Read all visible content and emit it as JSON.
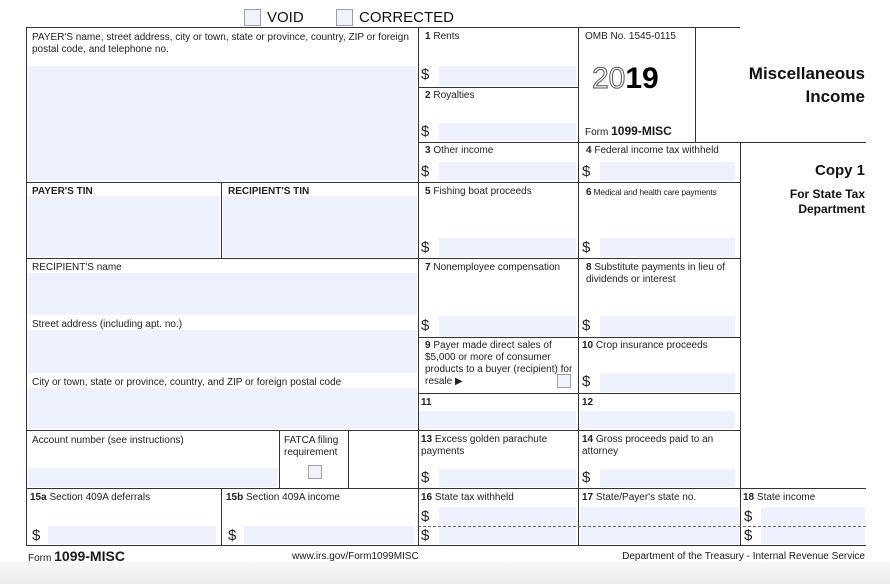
{
  "header": {
    "void_label": "VOID",
    "corrected_label": "CORRECTED"
  },
  "payer_block": {
    "label": "PAYER'S name, street address, city or town, state or province, country, ZIP or foreign postal code, and telephone no."
  },
  "payer_tin": {
    "label": "PAYER'S TIN"
  },
  "recipient_tin": {
    "label": "RECIPIENT'S TIN"
  },
  "recipient_name": {
    "label": "RECIPIENT'S name"
  },
  "street_address": {
    "label": "Street address (including apt. no.)"
  },
  "city": {
    "label": "City or town, state or province, country, and ZIP or foreign postal code"
  },
  "account_number": {
    "label": "Account number (see instructions)"
  },
  "fatca": {
    "label": "FATCA filing requirement",
    "checked": false
  },
  "omb": {
    "number": "OMB No. 1545-0115",
    "year_outline": "20",
    "year_bold": "19",
    "form_prefix": "Form",
    "form_name": "1099-MISC"
  },
  "title": {
    "line1": "Miscellaneous",
    "line2": "Income",
    "copy": "Copy 1",
    "copy_desc1": "For State Tax",
    "copy_desc2": "Department"
  },
  "currency_symbol": "$",
  "boxes": {
    "b1": {
      "num": "1",
      "label": "Rents",
      "value": ""
    },
    "b2": {
      "num": "2",
      "label": "Royalties",
      "value": ""
    },
    "b3": {
      "num": "3",
      "label": "Other income",
      "value": ""
    },
    "b4": {
      "num": "4",
      "label": "Federal income tax withheld",
      "value": ""
    },
    "b5": {
      "num": "5",
      "label": "Fishing boat proceeds",
      "value": ""
    },
    "b6": {
      "num": "6",
      "label": "Medical and health care payments",
      "value": ""
    },
    "b7": {
      "num": "7",
      "label": "Nonemployee compensation",
      "value": ""
    },
    "b8": {
      "num": "8",
      "label": "Substitute payments in lieu of dividends or interest",
      "value": ""
    },
    "b9": {
      "num": "9",
      "label": "Payer made direct sales of $5,000 or more of consumer products to a buyer (recipient) for resale ▶",
      "checked": false
    },
    "b10": {
      "num": "10",
      "label": "Crop insurance proceeds",
      "value": ""
    },
    "b11": {
      "num": "11",
      "label": "",
      "value": ""
    },
    "b12": {
      "num": "12",
      "label": "",
      "value": ""
    },
    "b13": {
      "num": "13",
      "label": "Excess golden parachute payments",
      "value": ""
    },
    "b14": {
      "num": "14",
      "label": "Gross proceeds paid to an attorney",
      "value": ""
    },
    "b15a": {
      "num": "15a",
      "label": "Section 409A deferrals",
      "value": ""
    },
    "b15b": {
      "num": "15b",
      "label": "Section 409A income",
      "value": ""
    },
    "b16": {
      "num": "16",
      "label": "State tax withheld",
      "values": [
        "",
        ""
      ]
    },
    "b17": {
      "num": "17",
      "label": "State/Payer's state no.",
      "values": [
        "",
        ""
      ]
    },
    "b18": {
      "num": "18",
      "label": "State income",
      "values": [
        "",
        ""
      ]
    }
  },
  "footer": {
    "form_prefix": "Form",
    "form_name": "1099-MISC",
    "url": "www.irs.gov/Form1099MISC",
    "agency": "Department of the Treasury - Internal Revenue Service"
  }
}
